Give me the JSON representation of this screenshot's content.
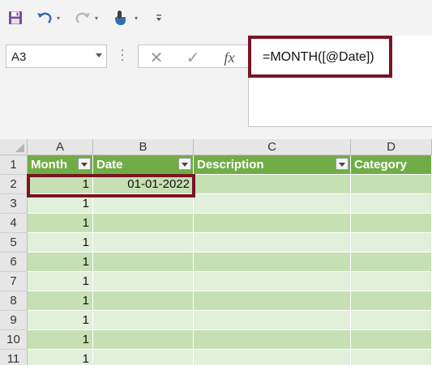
{
  "toolbar": {
    "save_icon": "save-icon",
    "undo_icon": "undo-icon",
    "redo_icon": "redo-icon",
    "touch_icon": "touch-mode-icon",
    "customize_icon": "customize-toolbar-icon"
  },
  "formula_bar": {
    "name_box": "A3",
    "cancel_glyph": "✕",
    "enter_glyph": "✓",
    "fx_label": "fx",
    "formula": "=MONTH([@Date])"
  },
  "sheet": {
    "columns": [
      "A",
      "B",
      "C",
      "D"
    ],
    "rows": [
      "1",
      "2",
      "3",
      "4",
      "5",
      "6",
      "7",
      "8",
      "9",
      "10",
      "11"
    ],
    "table_headers": [
      "Month",
      "Date",
      "Description",
      "Category"
    ],
    "table_rows": [
      {
        "month": "1",
        "date": "01-01-2022",
        "description": "",
        "category": ""
      },
      {
        "month": "1",
        "date": "",
        "description": "",
        "category": ""
      },
      {
        "month": "1",
        "date": "",
        "description": "",
        "category": ""
      },
      {
        "month": "1",
        "date": "",
        "description": "",
        "category": ""
      },
      {
        "month": "1",
        "date": "",
        "description": "",
        "category": ""
      },
      {
        "month": "1",
        "date": "",
        "description": "",
        "category": ""
      },
      {
        "month": "1",
        "date": "",
        "description": "",
        "category": ""
      },
      {
        "month": "1",
        "date": "",
        "description": "",
        "category": ""
      },
      {
        "month": "1",
        "date": "",
        "description": "",
        "category": ""
      },
      {
        "month": "1",
        "date": "",
        "description": "",
        "category": ""
      }
    ]
  },
  "colors": {
    "table_header": "#70ad47",
    "band_dark": "#c6e0b4",
    "band_light": "#e2efda",
    "highlight": "#7b1424"
  }
}
